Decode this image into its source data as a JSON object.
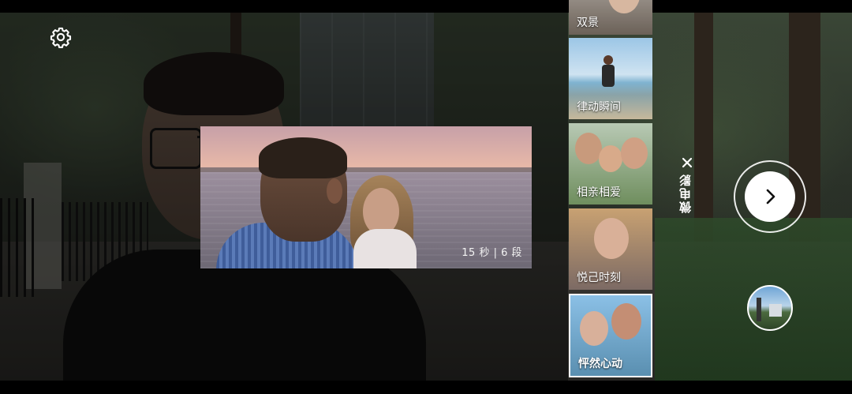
{
  "camera": {
    "mode_label": "微电影",
    "settings_icon": "gear-icon",
    "close_icon": "close-icon",
    "next_icon": "chevron-right-icon"
  },
  "preview": {
    "caption": "15 秒 | 6 段"
  },
  "templates": [
    {
      "label": "双景",
      "selected": false
    },
    {
      "label": "律动瞬间",
      "selected": false
    },
    {
      "label": "相亲相爱",
      "selected": false
    },
    {
      "label": "悦己时刻",
      "selected": false
    },
    {
      "label": "怦然心动",
      "selected": true
    }
  ]
}
